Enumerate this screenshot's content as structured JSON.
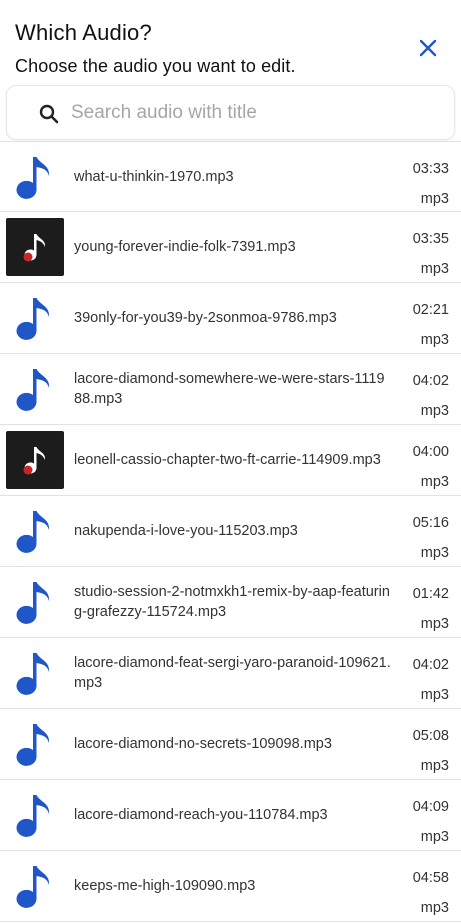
{
  "header": {
    "title": "Which Audio?",
    "subtitle": "Choose the audio you want to edit.",
    "close_icon": "close-icon",
    "accent_color": "#1f56c8"
  },
  "search": {
    "icon": "search-icon",
    "placeholder": "Search audio with title",
    "value": ""
  },
  "audio_list": [
    {
      "title": "what-u-thinkin-1970.mp3",
      "duration": "03:33",
      "format": "mp3",
      "thumbnail": "music-note-icon"
    },
    {
      "title": "young-forever-indie-folk-7391.mp3",
      "duration": "03:35",
      "format": "mp3",
      "thumbnail": "album-art-icon"
    },
    {
      "title": "39only-for-you39-by-2sonmoa-9786.mp3",
      "duration": "02:21",
      "format": "mp3",
      "thumbnail": "music-note-icon"
    },
    {
      "title": "lacore-diamond-somewhere-we-were-stars-111988.mp3",
      "duration": "04:02",
      "format": "mp3",
      "thumbnail": "music-note-icon"
    },
    {
      "title": "leonell-cassio-chapter-two-ft-carrie-114909.mp3",
      "duration": "04:00",
      "format": "mp3",
      "thumbnail": "album-art-icon"
    },
    {
      "title": "nakupenda-i-love-you-115203.mp3",
      "duration": "05:16",
      "format": "mp3",
      "thumbnail": "music-note-icon"
    },
    {
      "title": "studio-session-2-notmxkh1-remix-by-aap-featuring-grafezzy-115724.mp3",
      "duration": "01:42",
      "format": "mp3",
      "thumbnail": "music-note-icon"
    },
    {
      "title": "lacore-diamond-feat-sergi-yaro-paranoid-109621.mp3",
      "duration": "04:02",
      "format": "mp3",
      "thumbnail": "music-note-icon"
    },
    {
      "title": "lacore-diamond-no-secrets-109098.mp3",
      "duration": "05:08",
      "format": "mp3",
      "thumbnail": "music-note-icon"
    },
    {
      "title": "lacore-diamond-reach-you-110784.mp3",
      "duration": "04:09",
      "format": "mp3",
      "thumbnail": "music-note-icon"
    },
    {
      "title": "keeps-me-high-109090.mp3",
      "duration": "04:58",
      "format": "mp3",
      "thumbnail": "music-note-icon"
    }
  ]
}
